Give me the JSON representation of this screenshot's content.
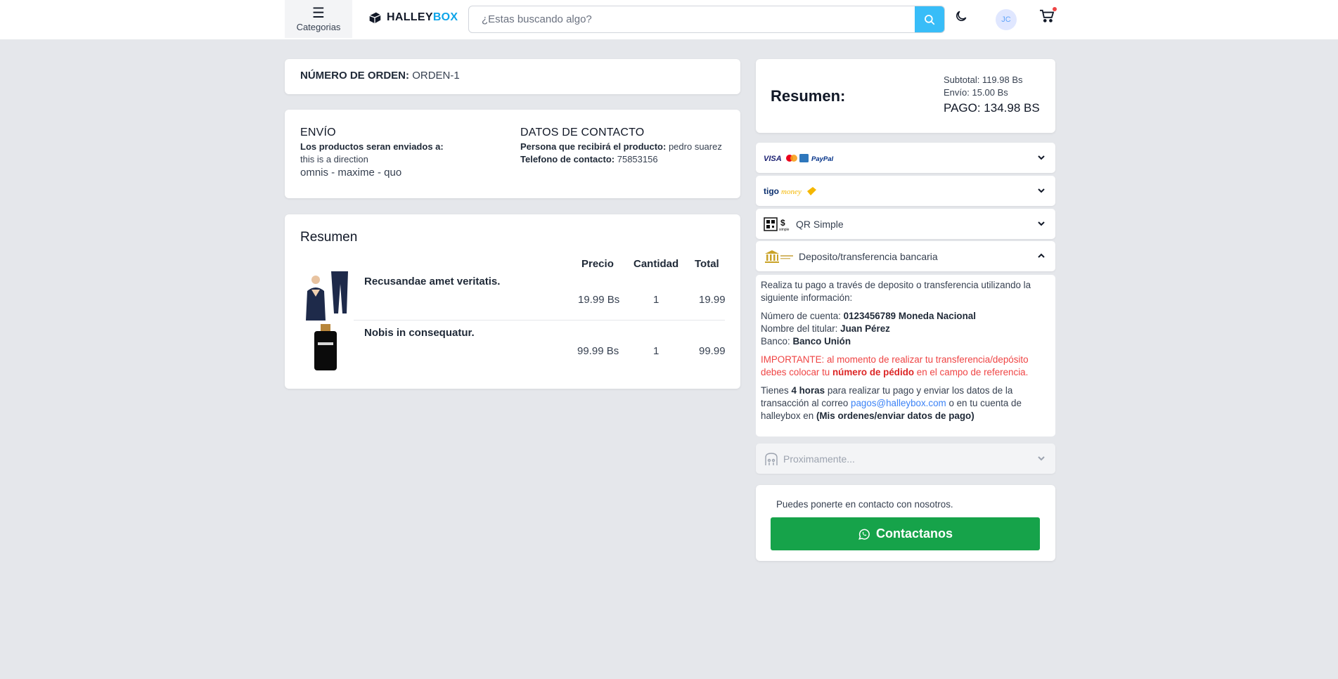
{
  "header": {
    "categories_label": "Categorias",
    "logo_part1": "HALLEY",
    "logo_part2": "BOX",
    "search_placeholder": "¿Estas buscando algo?",
    "avatar_initials": "JC",
    "accent_color": "#38bdf8"
  },
  "order": {
    "label": "NÚMERO DE ORDEN:",
    "value": "ORDEN-1"
  },
  "shipping": {
    "title": "ENVÍO",
    "subtitle": "Los productos seran enviados a:",
    "address": "this is a direction",
    "location": "omnis - maxime - quo"
  },
  "contact": {
    "title": "DATOS DE CONTACTO",
    "person_label": "Persona que recibirá el producto:",
    "person_value": "pedro suarez",
    "phone_label": "Telefono de contacto:",
    "phone_value": "75853156"
  },
  "summary": {
    "title": "Resumen",
    "columns": [
      "Precio",
      "Cantidad",
      "Total"
    ],
    "items": [
      {
        "name": "Recusandae amet veritatis.",
        "price": "19.99 Bs",
        "qty": "1",
        "total": "19.99"
      },
      {
        "name": "Nobis in consequatur.",
        "price": "99.99 Bs",
        "qty": "1",
        "total": "99.99"
      }
    ]
  },
  "totals": {
    "title": "Resumen:",
    "subtotal": "Subtotal: 119.98 Bs",
    "envio": "Envío: 15.00 Bs",
    "pago": "PAGO: 134.98 BS"
  },
  "payment_methods": {
    "cards_labels": [
      "VISA",
      "PayPal"
    ],
    "tigo_label": "tigomoney",
    "qr_label": "QR Simple",
    "deposit_label": "Deposito/transferencia bancaria",
    "coming_label": "Proximamente..."
  },
  "deposit": {
    "intro": "Realiza tu pago a través de deposito o transferencia utilizando la siguiente información:",
    "account_label": "Número de cuenta:",
    "account_value": "0123456789 Moneda Nacional",
    "holder_label": "Nombre del titular:",
    "holder_value": "Juan Pérez",
    "bank_label": "Banco:",
    "bank_value": "Banco Unión",
    "important_1": "IMPORTANTE: al momento de realizar tu transferencia/depósito debes colocar tu",
    "important_bold": "número de pédido",
    "important_2": "en el campo de referencia.",
    "time_1": "Tienes",
    "time_bold": "4 horas",
    "time_2": "para realizar tu pago y enviar los datos de la transacción al correo",
    "email": "pagos@halleybox.com",
    "time_3": "o en tu cuenta de halleybox en",
    "time_bold2": "(Mis ordenes/enviar datos de pago)"
  },
  "contact_us": {
    "message": "Puedes ponerte en contacto con nosotros.",
    "button": "Contactanos",
    "button_color": "#16a34a"
  }
}
